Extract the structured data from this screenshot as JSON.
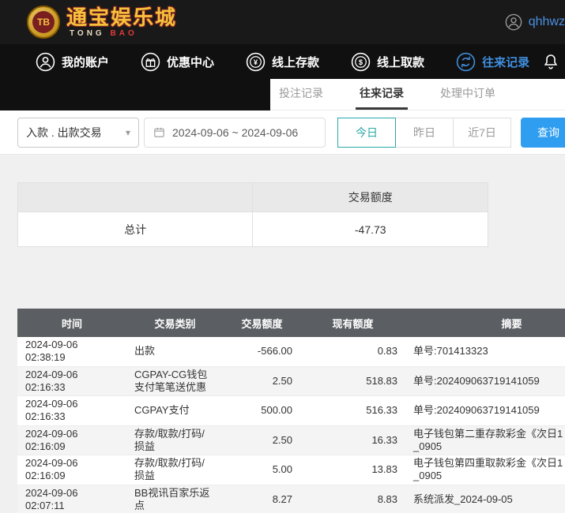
{
  "topbar": {
    "logo": {
      "coin_text": "TB",
      "title": "通宝娱乐城",
      "subtitle_1": "TONG",
      "subtitle_2": "BAO"
    },
    "username": "qhhwz"
  },
  "nav": {
    "items": [
      {
        "label": "我的账户"
      },
      {
        "label": "优惠中心"
      },
      {
        "label": "线上存款"
      },
      {
        "label": "线上取款"
      },
      {
        "label": "往来记录"
      }
    ]
  },
  "tabs": {
    "betting": "投注记录",
    "transactions": "往来记录",
    "processing": "处理中订单"
  },
  "filters": {
    "type_value": "入款 . 出款交易",
    "date_range": "2024-09-06 ~ 2024-09-06",
    "today": "今日",
    "yesterday": "昨日",
    "last7": "近7日",
    "search": "查询"
  },
  "summary": {
    "header": "交易额度",
    "total_label": "总计",
    "total_value": "-47.73"
  },
  "table": {
    "headers": {
      "time": "时间",
      "type": "交易类别",
      "amount": "交易额度",
      "balance": "现有额度",
      "summary": "摘要"
    },
    "rows": [
      {
        "time": "2024-09-06 02:38:19",
        "type": "出款",
        "amount": "-566.00",
        "balance": "0.83",
        "summary": "单号:701413323"
      },
      {
        "time": "2024-09-06 02:16:33",
        "type": "CGPAY-CG钱包\n支付笔笔送优惠",
        "amount": "2.50",
        "balance": "518.83",
        "summary": "单号:202409063719141059"
      },
      {
        "time": "2024-09-06 02:16:33",
        "type": "CGPAY支付",
        "amount": "500.00",
        "balance": "516.33",
        "summary": "单号:202409063719141059"
      },
      {
        "time": "2024-09-06 02:16:09",
        "type": "存款/取款/打码/\n损益",
        "amount": "2.50",
        "balance": "16.33",
        "summary": "电子钱包第二重存款彩金《次日1\n_0905"
      },
      {
        "time": "2024-09-06 02:16:09",
        "type": "存款/取款/打码/\n损益",
        "amount": "5.00",
        "balance": "13.83",
        "summary": "电子钱包第四重取款彩金《次日1\n_0905"
      },
      {
        "time": "2024-09-06 02:07:11",
        "type": "BB视讯百家乐返\n点",
        "amount": "8.27",
        "balance": "8.83",
        "summary": "系统派发_2024-09-05"
      }
    ]
  },
  "colors": {
    "accent_blue": "#4090e0",
    "teal_active": "#2aa8a8",
    "search_button_blue": "#2f9df0",
    "table_header_gray": "#5b5e62"
  }
}
